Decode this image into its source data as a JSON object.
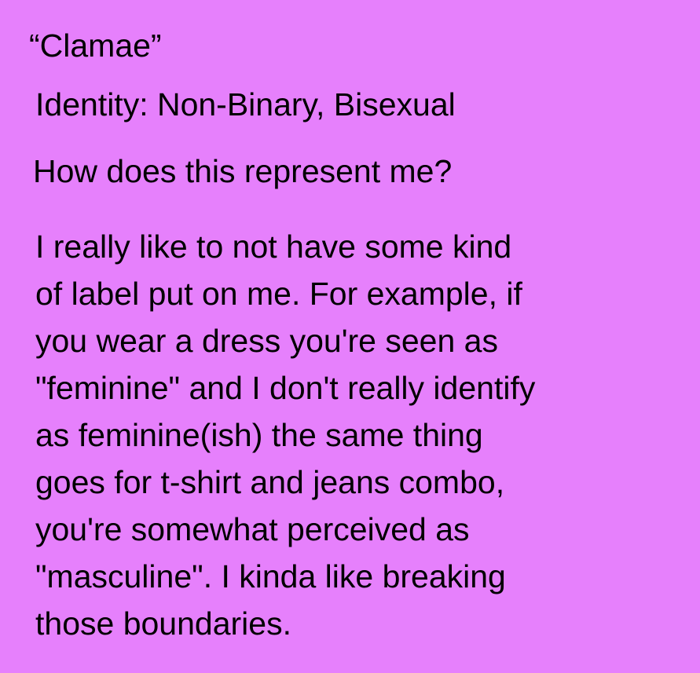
{
  "title": "“Clamae”",
  "identity": "Identity: Non-Binary, Bisexual",
  "question": "How does this represent me?",
  "body_lines": [
    "I really like to not have some kind",
    "of label put on me. For example, if",
    "you wear a dress you're seen as",
    "\"feminine\" and I don't really identify",
    "as feminine(ish) the same thing",
    "goes for t-shirt and jeans combo,",
    "you're somewhat perceived as",
    "\"masculine\". I kinda like breaking",
    "those boundaries."
  ],
  "colors": {
    "background": "#e680fc",
    "text": "#000000"
  }
}
